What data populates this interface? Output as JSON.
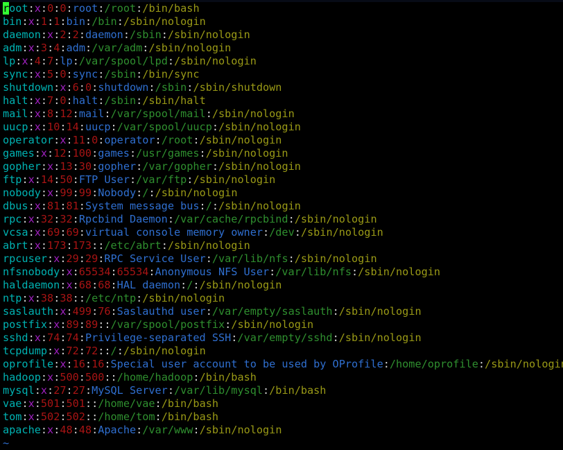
{
  "terminal": {
    "app": "vim-passwd-viewer",
    "file": "/etc/passwd",
    "cursor": {
      "row": 1,
      "col": 1,
      "char": "r"
    },
    "colors": {
      "background": "#000000",
      "username": "#00b2b2",
      "separator": "#d8d8d8",
      "password": "#a020c0",
      "uid": "#a81414",
      "gid": "#a81414",
      "gecos": "#2f6fd0",
      "home": "#2f8f2f",
      "shell": "#9a9a16",
      "tilde": "#2f6fd0",
      "cursor_bg": "#33ff33",
      "cursor_fg": "#000000"
    },
    "field_order": [
      "username",
      "password",
      "uid",
      "gid",
      "gecos",
      "home",
      "shell"
    ],
    "empty_line_marker": "~",
    "rows": [
      {
        "username": "root",
        "password": "x",
        "uid": "0",
        "gid": "0",
        "gecos": "root",
        "home": "/root",
        "shell": "/bin/bash"
      },
      {
        "username": "bin",
        "password": "x",
        "uid": "1",
        "gid": "1",
        "gecos": "bin",
        "home": "/bin",
        "shell": "/sbin/nologin"
      },
      {
        "username": "daemon",
        "password": "x",
        "uid": "2",
        "gid": "2",
        "gecos": "daemon",
        "home": "/sbin",
        "shell": "/sbin/nologin"
      },
      {
        "username": "adm",
        "password": "x",
        "uid": "3",
        "gid": "4",
        "gecos": "adm",
        "home": "/var/adm",
        "shell": "/sbin/nologin"
      },
      {
        "username": "lp",
        "password": "x",
        "uid": "4",
        "gid": "7",
        "gecos": "lp",
        "home": "/var/spool/lpd",
        "shell": "/sbin/nologin"
      },
      {
        "username": "sync",
        "password": "x",
        "uid": "5",
        "gid": "0",
        "gecos": "sync",
        "home": "/sbin",
        "shell": "/bin/sync"
      },
      {
        "username": "shutdown",
        "password": "x",
        "uid": "6",
        "gid": "0",
        "gecos": "shutdown",
        "home": "/sbin",
        "shell": "/sbin/shutdown"
      },
      {
        "username": "halt",
        "password": "x",
        "uid": "7",
        "gid": "0",
        "gecos": "halt",
        "home": "/sbin",
        "shell": "/sbin/halt"
      },
      {
        "username": "mail",
        "password": "x",
        "uid": "8",
        "gid": "12",
        "gecos": "mail",
        "home": "/var/spool/mail",
        "shell": "/sbin/nologin"
      },
      {
        "username": "uucp",
        "password": "x",
        "uid": "10",
        "gid": "14",
        "gecos": "uucp",
        "home": "/var/spool/uucp",
        "shell": "/sbin/nologin"
      },
      {
        "username": "operator",
        "password": "x",
        "uid": "11",
        "gid": "0",
        "gecos": "operator",
        "home": "/root",
        "shell": "/sbin/nologin"
      },
      {
        "username": "games",
        "password": "x",
        "uid": "12",
        "gid": "100",
        "gecos": "games",
        "home": "/usr/games",
        "shell": "/sbin/nologin"
      },
      {
        "username": "gopher",
        "password": "x",
        "uid": "13",
        "gid": "30",
        "gecos": "gopher",
        "home": "/var/gopher",
        "shell": "/sbin/nologin"
      },
      {
        "username": "ftp",
        "password": "x",
        "uid": "14",
        "gid": "50",
        "gecos": "FTP User",
        "home": "/var/ftp",
        "shell": "/sbin/nologin"
      },
      {
        "username": "nobody",
        "password": "x",
        "uid": "99",
        "gid": "99",
        "gecos": "Nobody",
        "home": "/",
        "shell": "/sbin/nologin"
      },
      {
        "username": "dbus",
        "password": "x",
        "uid": "81",
        "gid": "81",
        "gecos": "System message bus",
        "home": "/",
        "shell": "/sbin/nologin"
      },
      {
        "username": "rpc",
        "password": "x",
        "uid": "32",
        "gid": "32",
        "gecos": "Rpcbind Daemon",
        "home": "/var/cache/rpcbind",
        "shell": "/sbin/nologin"
      },
      {
        "username": "vcsa",
        "password": "x",
        "uid": "69",
        "gid": "69",
        "gecos": "virtual console memory owner",
        "home": "/dev",
        "shell": "/sbin/nologin"
      },
      {
        "username": "abrt",
        "password": "x",
        "uid": "173",
        "gid": "173",
        "gecos": "",
        "home": "/etc/abrt",
        "shell": "/sbin/nologin"
      },
      {
        "username": "rpcuser",
        "password": "x",
        "uid": "29",
        "gid": "29",
        "gecos": "RPC Service User",
        "home": "/var/lib/nfs",
        "shell": "/sbin/nologin"
      },
      {
        "username": "nfsnobody",
        "password": "x",
        "uid": "65534",
        "gid": "65534",
        "gecos": "Anonymous NFS User",
        "home": "/var/lib/nfs",
        "shell": "/sbin/nologin"
      },
      {
        "username": "haldaemon",
        "password": "x",
        "uid": "68",
        "gid": "68",
        "gecos": "HAL daemon",
        "home": "/",
        "shell": "/sbin/nologin"
      },
      {
        "username": "ntp",
        "password": "x",
        "uid": "38",
        "gid": "38",
        "gecos": "",
        "home": "/etc/ntp",
        "shell": "/sbin/nologin"
      },
      {
        "username": "saslauth",
        "password": "x",
        "uid": "499",
        "gid": "76",
        "gecos": "Saslauthd user",
        "home": "/var/empty/saslauth",
        "shell": "/sbin/nologin"
      },
      {
        "username": "postfix",
        "password": "x",
        "uid": "89",
        "gid": "89",
        "gecos": "",
        "home": "/var/spool/postfix",
        "shell": "/sbin/nologin"
      },
      {
        "username": "sshd",
        "password": "x",
        "uid": "74",
        "gid": "74",
        "gecos": "Privilege-separated SSH",
        "home": "/var/empty/sshd",
        "shell": "/sbin/nologin"
      },
      {
        "username": "tcpdump",
        "password": "x",
        "uid": "72",
        "gid": "72",
        "gecos": "",
        "home": "/",
        "shell": "/sbin/nologin"
      },
      {
        "username": "oprofile",
        "password": "x",
        "uid": "16",
        "gid": "16",
        "gecos": "Special user account to be used by OProfile",
        "home": "/home/oprofile",
        "shell": "/sbin/nologin"
      },
      {
        "username": "hadoop",
        "password": "x",
        "uid": "500",
        "gid": "500",
        "gecos": "",
        "home": "/home/hadoop",
        "shell": "/bin/bash"
      },
      {
        "username": "mysql",
        "password": "x",
        "uid": "27",
        "gid": "27",
        "gecos": "MySQL Server",
        "home": "/var/lib/mysql",
        "shell": "/bin/bash"
      },
      {
        "username": "vae",
        "password": "x",
        "uid": "501",
        "gid": "501",
        "gecos": "",
        "home": "/home/vae",
        "shell": "/bin/bash"
      },
      {
        "username": "tom",
        "password": "x",
        "uid": "502",
        "gid": "502",
        "gecos": "",
        "home": "/home/tom",
        "shell": "/bin/bash"
      },
      {
        "username": "apache",
        "password": "x",
        "uid": "48",
        "gid": "48",
        "gecos": "Apache",
        "home": "/var/www",
        "shell": "/sbin/nologin"
      }
    ]
  }
}
